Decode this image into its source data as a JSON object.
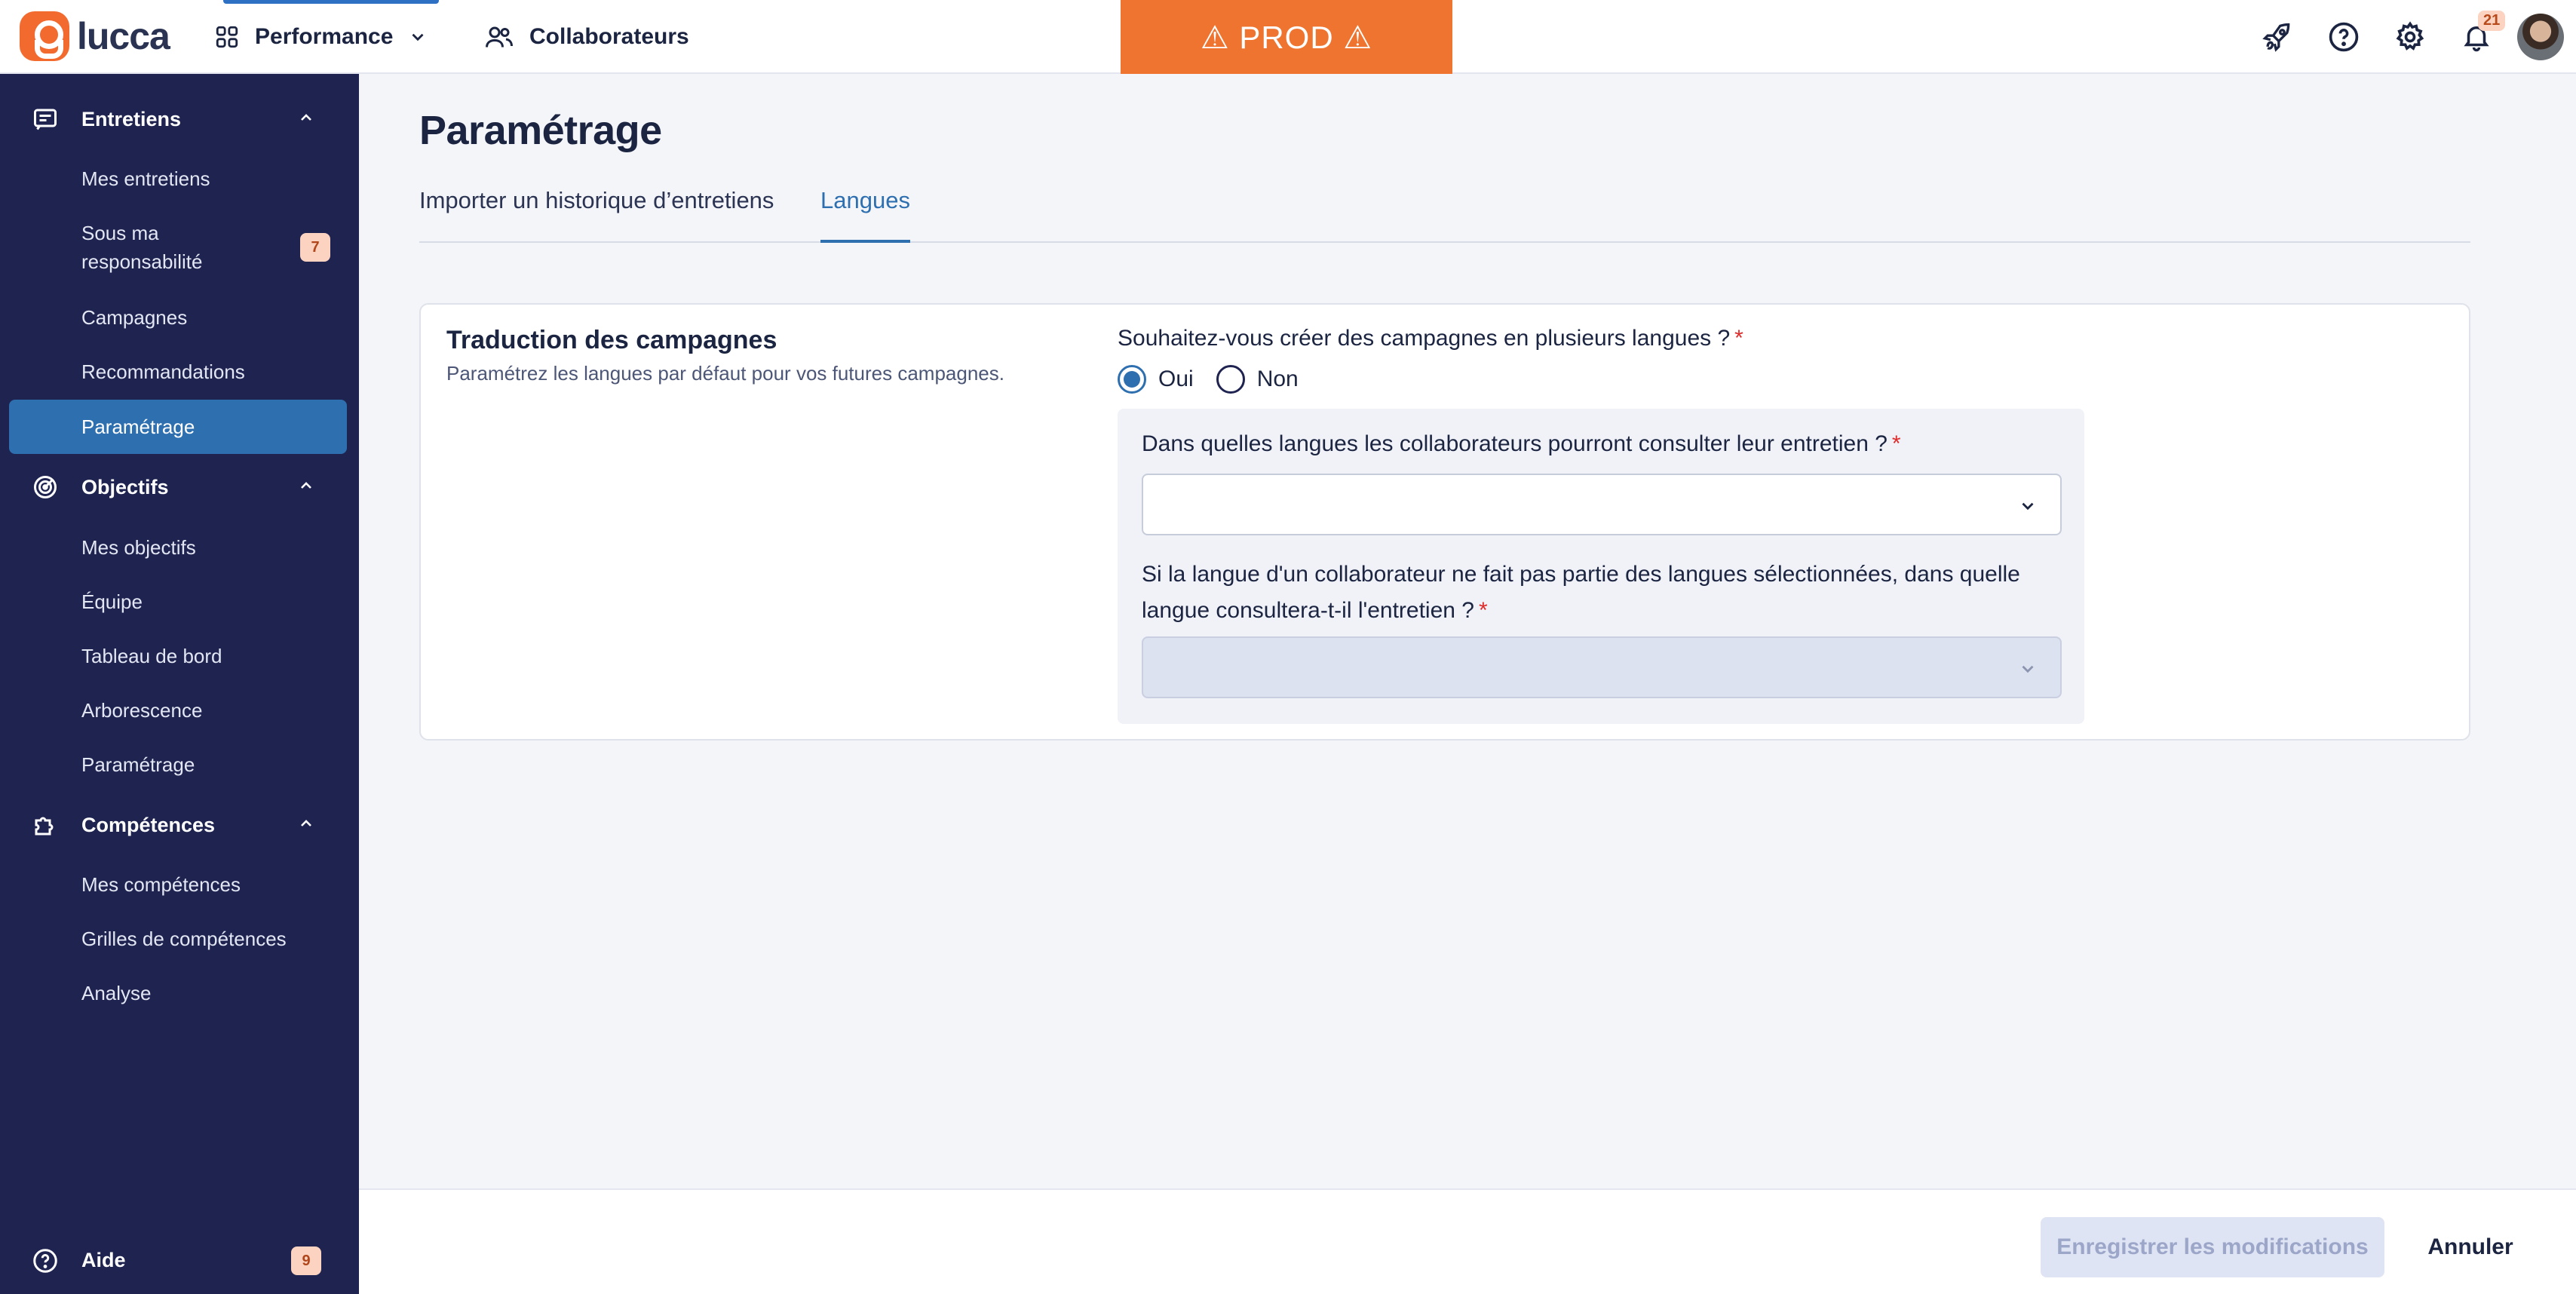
{
  "header": {
    "logo_text": "lucca",
    "apps": [
      {
        "label": "Performance",
        "icon": "grid-icon"
      },
      {
        "label": "Collaborateurs",
        "icon": "users-icon"
      }
    ],
    "prod_banner": "⚠ PROD ⚠",
    "notification_count": "21",
    "icons": [
      "rocket-icon",
      "help-icon",
      "settings-icon",
      "bell-icon",
      "avatar"
    ]
  },
  "sidebar": {
    "sections": [
      {
        "label": "Entretiens",
        "icon": "message-icon"
      },
      {
        "label": "Objectifs",
        "icon": "target-icon"
      },
      {
        "label": "Compétences",
        "icon": "puzzle-icon"
      }
    ],
    "items": {
      "mes_entretiens": "Mes entretiens",
      "sous_ma_resp_1": "Sous ma",
      "sous_ma_resp_2": "responsabilité",
      "sous_ma_resp_badge": "7",
      "campagnes": "Campagnes",
      "recommandations": "Recommandations",
      "parametrage_entretiens": "Paramétrage",
      "mes_objectifs": "Mes objectifs",
      "equipe": "Équipe",
      "tableau_de_bord": "Tableau de bord",
      "arborescence": "Arborescence",
      "parametrage_objectifs": "Paramétrage",
      "mes_competences": "Mes compétences",
      "grilles": "Grilles de compétences",
      "analyse": "Analyse"
    },
    "aide": {
      "label": "Aide",
      "badge": "9"
    }
  },
  "main": {
    "title": "Paramétrage",
    "tabs": [
      {
        "label": "Importer un historique d’entretiens",
        "active": false
      },
      {
        "label": "Langues",
        "active": true
      }
    ],
    "card": {
      "title": "Traduction des campagnes",
      "subtitle": "Paramétrez les langues par défaut pour vos futures campagnes.",
      "question1": "Souhaitez-vous créer des campagnes en plusieurs langues ?",
      "required_mark": "*",
      "options": [
        {
          "label": "Oui",
          "selected": true
        },
        {
          "label": "Non",
          "selected": false
        }
      ],
      "question2": "Dans quelles langues les collaborateurs pourront consulter leur entretien ?",
      "question3": "Si la langue d'un collaborateur ne fait pas partie des langues sélectionnées, dans quelle langue consultera-t-il l'entretien ?"
    }
  },
  "footer": {
    "save_label": "Enregistrer les modifications",
    "cancel_label": "Annuler"
  },
  "colors": {
    "sidebar_bg": "#1f2350",
    "accent": "#2e6fb0",
    "prod_banner": "#ee7430",
    "brand": "#f26a2e"
  }
}
